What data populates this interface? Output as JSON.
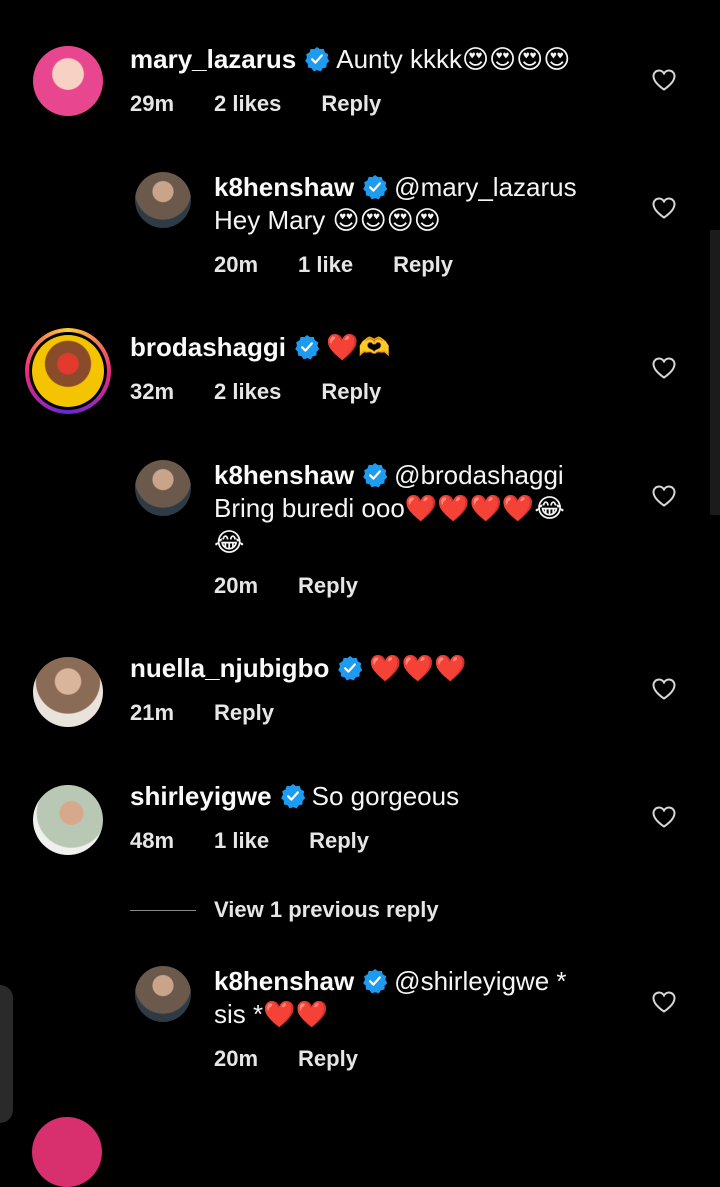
{
  "comments": [
    {
      "username": "mary_lazarus",
      "text_plain": "Aunty kkkk",
      "emojis": "😍😍😍😍",
      "time": "29m",
      "likes": "2 likes",
      "reply": "Reply",
      "avatar_color": "#e8478f"
    },
    {
      "username": "k8henshaw",
      "mention": "@mary_lazarus",
      "line2_text": "Hey Mary ",
      "line2_emojis": "😍😍😍😍",
      "time": "20m",
      "likes": "1 like",
      "reply": "Reply",
      "avatar_color": "#6b5a4c"
    },
    {
      "username": "brodashaggi",
      "emojis": "❤️",
      "extra": "🫶",
      "time": "32m",
      "likes": "2 likes",
      "reply": "Reply",
      "avatar_color": "#f4c400"
    },
    {
      "username": "k8henshaw",
      "mention": "@brodashaggi",
      "line2_text": "Bring buredi ooo",
      "line2_hearts": "❤️❤️❤️❤️",
      "line2_laugh": "😂",
      "line3": "😂",
      "time": "20m",
      "reply": "Reply",
      "avatar_color": "#6b5a4c"
    },
    {
      "username": "nuella_njubigbo",
      "emojis": "❤️❤️❤️",
      "time": "21m",
      "reply": "Reply",
      "avatar_color": "#8a6b55"
    },
    {
      "username": "shirleyigwe",
      "text_plain": "So gorgeous",
      "time": "48m",
      "likes": "1 like",
      "reply": "Reply",
      "avatar_color": "#b9c8b4"
    },
    {
      "username": "k8henshaw",
      "mention": "@shirleyigwe *",
      "line2_text": "sis *",
      "line2_hearts": "❤️❤️",
      "time": "20m",
      "reply": "Reply",
      "avatar_color": "#6b5a4c"
    }
  ],
  "view_replies": "View 1 previous reply",
  "colors": {
    "background": "#000000",
    "verified_blue": "#1d9bf0",
    "heart_red": "#e0151f"
  },
  "icons": {
    "verified": "verified-badge-icon",
    "like": "heart-outline-icon"
  }
}
